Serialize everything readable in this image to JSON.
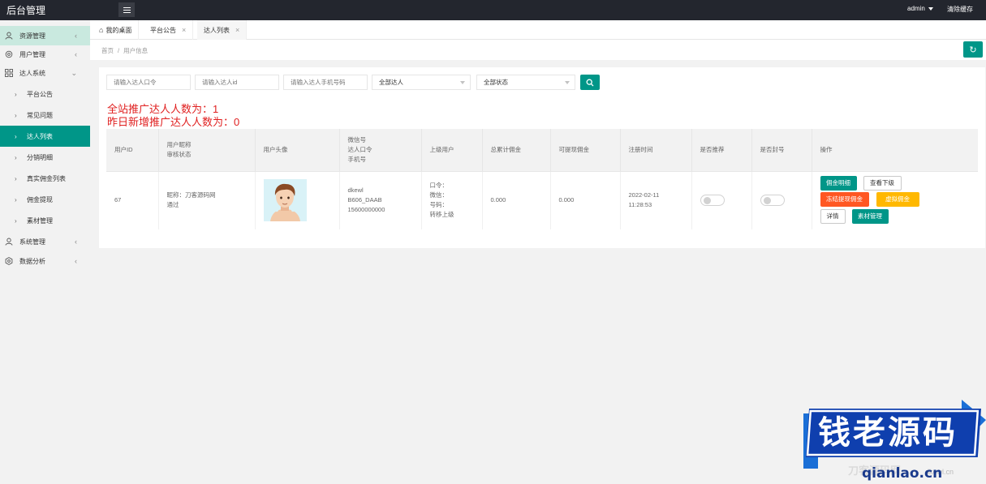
{
  "app": {
    "title": "后台管理",
    "user": "admin",
    "clear_cache": "清除缓存"
  },
  "sidebar": {
    "groups": [
      {
        "label": "资源管理",
        "icon": "user-icon"
      },
      {
        "label": "用户管理",
        "icon": "gear-icon"
      },
      {
        "label": "达人系统",
        "icon": "grid-icon"
      },
      {
        "label": "系统管理",
        "icon": "user-icon"
      },
      {
        "label": "数据分析",
        "icon": "gear-icon"
      }
    ],
    "subitems": [
      "平台公告",
      "常见问题",
      "达人列表",
      "分销明细",
      "真实佣金列表",
      "佣金提现",
      "素材管理"
    ]
  },
  "tabs": [
    {
      "label": "我的桌面"
    },
    {
      "label": "平台公告"
    },
    {
      "label": "达人列表"
    }
  ],
  "breadcrumb": {
    "home": "首页",
    "sep": "/",
    "current": "用户信息"
  },
  "filters": {
    "code_placeholder": "请输入达人口令",
    "id_placeholder": "请输入达人id",
    "phone_placeholder": "请输入达人手机号码",
    "type_value": "全部达人",
    "status_value": "全部状态"
  },
  "stats": {
    "total": "全站推广达人人数为：1",
    "new_yesterday": "昨日新增推广达人人数为：0"
  },
  "table": {
    "headers": {
      "user_id": "用户ID",
      "nick_a": "用户昵称",
      "nick_b": "审核状态",
      "avatar": "用户头像",
      "wx_a": "微信号",
      "wx_b": "达人口令",
      "wx_c": "手机号",
      "parent": "上级用户",
      "total_commission": "总累计佣金",
      "withdrawable": "可提现佣金",
      "reg_time": "注册时间",
      "recommend": "是否推荐",
      "banned": "是否封号",
      "ops": "操作"
    },
    "row": {
      "user_id": "67",
      "nickname": "昵称：刀客源码网",
      "status": "通过",
      "wechat": "dkewl",
      "code": "B606_DAAB",
      "phone": "15600000000",
      "parent_code": "口令：",
      "parent_wx": "微信：",
      "parent_phone": "号码：",
      "parent_move": "转移上级",
      "total_commission": "0.000",
      "withdrawable": "0.000",
      "reg_date": "2022-02-11",
      "reg_clock": "11:28:53",
      "recommend_on": false,
      "banned_on": false
    },
    "ops": {
      "commission_detail": "佣金明细",
      "view_sub": "查看下级",
      "freeze": "冻结提现佣金",
      "fake_commission": "虚拟佣金",
      "detail": "详情",
      "material": "素材管理"
    }
  },
  "watermark": {
    "title": "钱老源码",
    "url": "qianlao.cn",
    "faint": "刀客源码网",
    "faint_url": "dkewl.cn"
  },
  "colors": {
    "accent": "#009688",
    "danger": "#ff5722",
    "warn": "#ffb800",
    "stat_red": "#e02020",
    "topbar": "#23262e"
  }
}
